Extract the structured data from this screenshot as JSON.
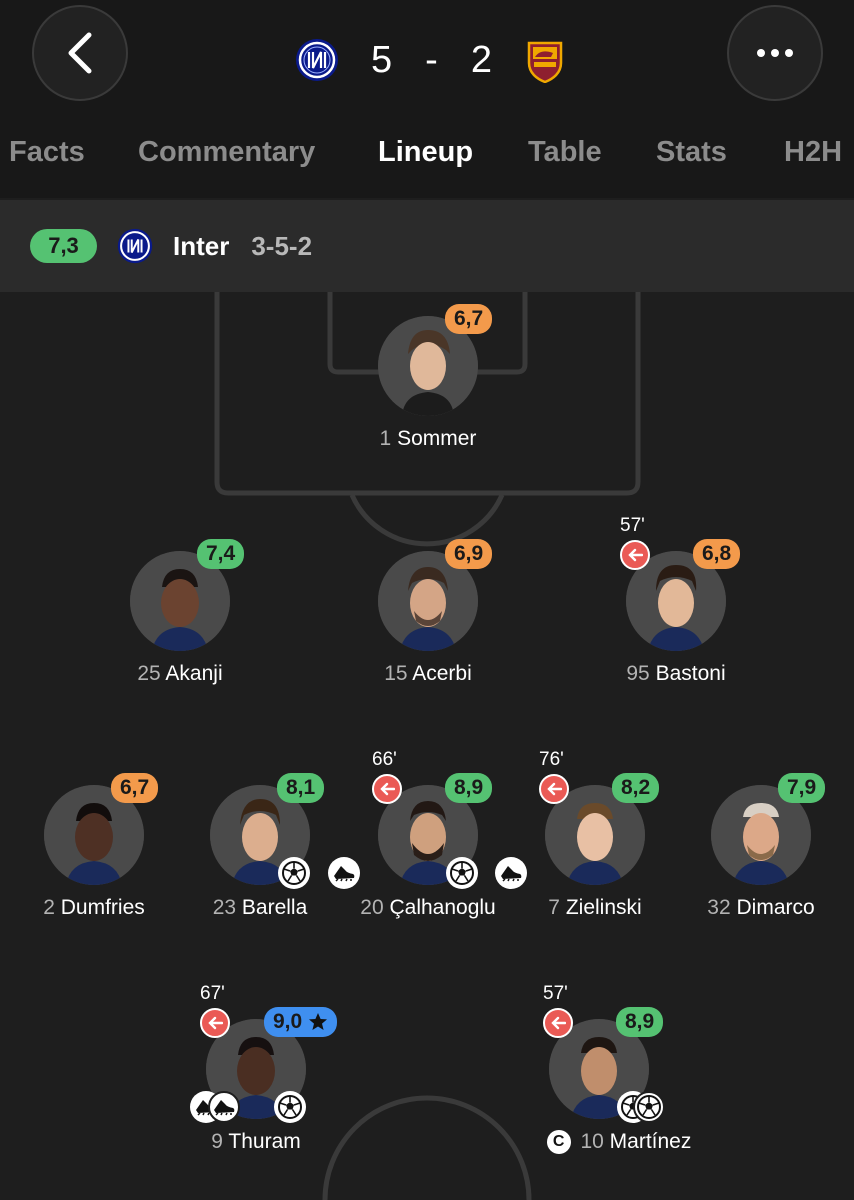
{
  "match": {
    "home_score": "5",
    "separator": "-",
    "away_score": "2"
  },
  "tabs": [
    {
      "label": "Facts"
    },
    {
      "label": "Commentary"
    },
    {
      "label": "Lineup"
    },
    {
      "label": "Table"
    },
    {
      "label": "Stats"
    },
    {
      "label": "H2H"
    }
  ],
  "active_tab": "Lineup",
  "team": {
    "rating": "7,3",
    "name": "Inter",
    "formation": "3-5-2"
  },
  "players": [
    {
      "number": "1",
      "name": "Sommer",
      "rating": "6,7",
      "rating_color": "orange"
    },
    {
      "number": "25",
      "name": "Akanji",
      "rating": "7,4",
      "rating_color": "green"
    },
    {
      "number": "15",
      "name": "Acerbi",
      "rating": "6,9",
      "rating_color": "orange"
    },
    {
      "number": "95",
      "name": "Bastoni",
      "rating": "6,8",
      "rating_color": "orange",
      "sub_minute": "57'"
    },
    {
      "number": "2",
      "name": "Dumfries",
      "rating": "6,7",
      "rating_color": "orange"
    },
    {
      "number": "23",
      "name": "Barella",
      "rating": "8,1",
      "rating_color": "green"
    },
    {
      "number": "20",
      "name": "Çalhanoglu",
      "rating": "8,9",
      "rating_color": "green",
      "sub_minute": "66'"
    },
    {
      "number": "7",
      "name": "Zielinski",
      "rating": "8,2",
      "rating_color": "green",
      "sub_minute": "76'"
    },
    {
      "number": "32",
      "name": "Dimarco",
      "rating": "7,9",
      "rating_color": "green"
    },
    {
      "number": "9",
      "name": "Thuram",
      "rating": "9,0",
      "rating_color": "blue",
      "sub_minute": "67'"
    },
    {
      "number": "10",
      "name": "Martínez",
      "rating": "8,9",
      "rating_color": "green",
      "sub_minute": "57'"
    }
  ],
  "icons": {
    "back": "back-chevron-icon",
    "more": "more-dots-icon",
    "substitution": "substitution-arrow-icon",
    "goal": "football-icon",
    "assist": "boot-icon",
    "captain": "captain-icon",
    "player_of_match": "star-icon"
  },
  "captain_label": "C",
  "colors": {
    "green": "#55c272",
    "orange": "#f39a4b",
    "blue": "#3f8ff0",
    "sub_red": "#ea5a55",
    "background": "#1e1e1e"
  }
}
